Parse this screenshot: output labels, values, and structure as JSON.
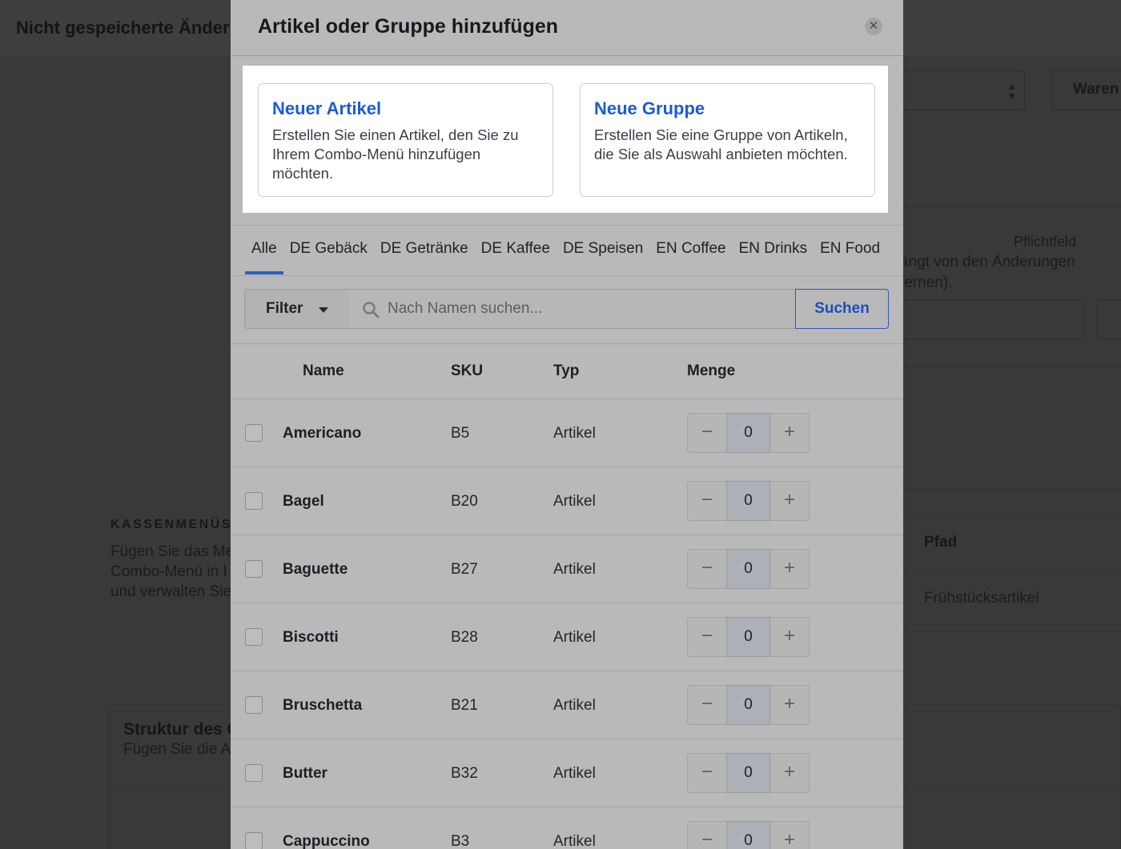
{
  "background": {
    "unsaved_title": "Nicht gespeicherte Änderu",
    "waren_label": "Waren",
    "required_label": "Pflichtfeld",
    "hint_line1": "ängt von den Änderungen",
    "hint_line2": "fernen).",
    "section_heading": "KASSENMENÜS",
    "section_desc": [
      "Fügen Sie das Me",
      "Combo-Menü in I",
      "und verwalten Sie"
    ],
    "table_header_path": "Pfad",
    "table_cell_path": "Frühstücksartikel",
    "structure_title": "Struktur des C",
    "structure_desc": "Fügen Sie die Ar"
  },
  "modal": {
    "title": "Artikel oder Gruppe hinzufügen",
    "close_symbol": "✕",
    "options": [
      {
        "title": "Neuer Artikel",
        "description": "Erstellen Sie einen Artikel, den Sie zu Ihrem Combo-Menü hinzufügen möchten."
      },
      {
        "title": "Neue Gruppe",
        "description": "Erstellen Sie eine Gruppe von Artikeln, die Sie als Auswahl anbieten möchten."
      }
    ],
    "tabs": [
      "Alle",
      "DE Gebäck",
      "DE Getränke",
      "DE Kaffee",
      "DE Speisen",
      "EN Coffee",
      "EN Drinks",
      "EN Food"
    ],
    "active_tab": "Alle",
    "filter_label": "Filter",
    "search_placeholder": "Nach Namen suchen...",
    "search_button": "Suchen",
    "columns": {
      "name": "Name",
      "sku": "SKU",
      "type": "Typ",
      "quantity": "Menge"
    },
    "rows": [
      {
        "name": "Americano",
        "sku": "B5",
        "type": "Artikel",
        "quantity": "0"
      },
      {
        "name": "Bagel",
        "sku": "B20",
        "type": "Artikel",
        "quantity": "0"
      },
      {
        "name": "Baguette",
        "sku": "B27",
        "type": "Artikel",
        "quantity": "0"
      },
      {
        "name": "Biscotti",
        "sku": "B28",
        "type": "Artikel",
        "quantity": "0"
      },
      {
        "name": "Bruschetta",
        "sku": "B21",
        "type": "Artikel",
        "quantity": "0"
      },
      {
        "name": "Butter",
        "sku": "B32",
        "type": "Artikel",
        "quantity": "0"
      },
      {
        "name": "Cappuccino",
        "sku": "B3",
        "type": "Artikel",
        "quantity": "0"
      }
    ],
    "stepper_minus": "−",
    "stepper_plus": "+"
  },
  "colors": {
    "accent_blue": "#1a5cd6",
    "tab_underline": "#2b60c7"
  },
  "icons": {
    "close": "close-icon",
    "search": "search-icon",
    "filter_dropdown": "caret-down-icon",
    "select_sort": "sort-arrows-icon"
  }
}
